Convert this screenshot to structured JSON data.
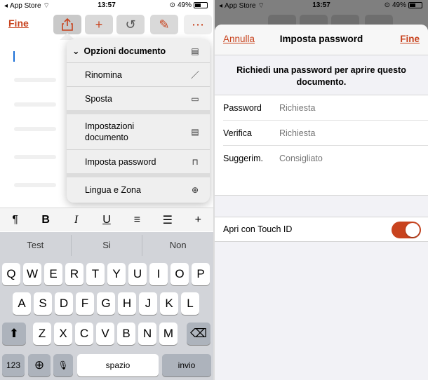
{
  "left": {
    "status": {
      "carrier": "App Store",
      "time": "13:57",
      "battery": "49%"
    },
    "toolbar": {
      "done_label": "Fine"
    },
    "menu": {
      "title": "Opzioni documento",
      "items": [
        {
          "label": "Rinomina",
          "icon": "pencil-icon"
        },
        {
          "label": "Sposta",
          "icon": "folder-icon"
        },
        {
          "label": "Impostazioni\ndocumento",
          "icon": "document-icon"
        },
        {
          "label": "Imposta password",
          "icon": "lock-icon"
        },
        {
          "label": "Lingua e Zona",
          "icon": "globe-icon"
        }
      ]
    },
    "format_bar": [
      "¶",
      "B",
      "I",
      "U",
      "≡",
      "☰",
      "+"
    ],
    "keyboard": {
      "suggestions": [
        "Test",
        "Si",
        "Non"
      ],
      "row1": [
        "Q",
        "W",
        "E",
        "R",
        "T",
        "Y",
        "U",
        "I",
        "O",
        "P"
      ],
      "row2": [
        "A",
        "S",
        "D",
        "F",
        "G",
        "H",
        "J",
        "K",
        "L"
      ],
      "row3": [
        "Z",
        "X",
        "C",
        "V",
        "B",
        "N",
        "M"
      ],
      "numbers_key": "123",
      "space_key": "spazio",
      "return_key": "invio"
    }
  },
  "right": {
    "status": {
      "carrier": "App Store",
      "time": "13:57",
      "battery": "49%"
    },
    "sheet": {
      "cancel_label": "Annulla",
      "title": "Imposta password",
      "done_label": "Fine",
      "prompt": "Richiedi una password per aprire questo documento.",
      "fields": [
        {
          "label": "Password",
          "placeholder": "Richiesta"
        },
        {
          "label": "Verifica",
          "placeholder": "Richiesta"
        },
        {
          "label": "Suggerim.",
          "placeholder": "Consigliato"
        }
      ],
      "touch_id_label": "Apri con Touch ID",
      "touch_id_on": true
    }
  },
  "colors": {
    "accent": "#c8431e",
    "keyboard_bg": "#d2d4d9",
    "dim_overlay": "#7f7f7f"
  }
}
